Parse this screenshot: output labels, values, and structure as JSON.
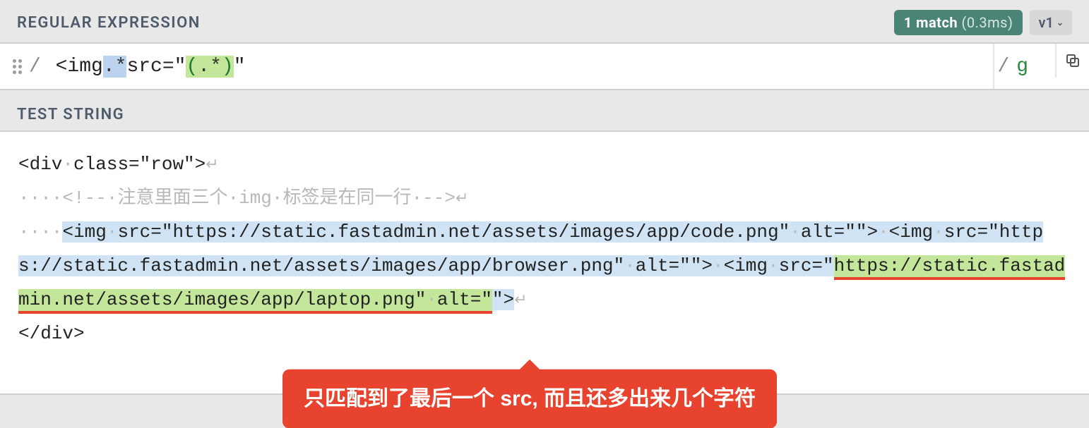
{
  "header": {
    "regex_label": "REGULAR EXPRESSION",
    "match_count": "1 match",
    "match_time": "(0.3ms)",
    "version": "v1"
  },
  "regex": {
    "open_slash": "/",
    "pattern_prefix": " <img",
    "pattern_dotstar1": ".*",
    "pattern_src": "src=",
    "pattern_q1": "\"",
    "pattern_open_paren": "(",
    "pattern_dotstar2": ".*",
    "pattern_close_paren": ")",
    "pattern_q2": "\"",
    "close_slash": "/ ",
    "flags": "g"
  },
  "teststring": {
    "label": "TEST STRING",
    "line1": "<div·class=\"row\">",
    "line2_prefix": "····<!--·注意里面三个·img·标签是在同一行·-->",
    "line3_indent": "····",
    "line3_match_part1": "<img·src=\"https://static.fastadmin.net/assets/images/app/code.png\"·alt=\"\">",
    "line3_sep": "·",
    "line4_match_part2": "<img·src=\"https://static.fastadmin.net/assets/images/app/browser.png\"·alt=\"\">",
    "line4_sep": "·",
    "line5_prefix": "<img·src=\"",
    "line5_group": "https://static.fastadmin.net/assets/images/app/laptop.png\"·alt=\"",
    "line5_suffix": "\">",
    "line6": "</div>"
  },
  "annotation": {
    "text": "只匹配到了最后一个 src, 而且还多出来几个字符"
  }
}
